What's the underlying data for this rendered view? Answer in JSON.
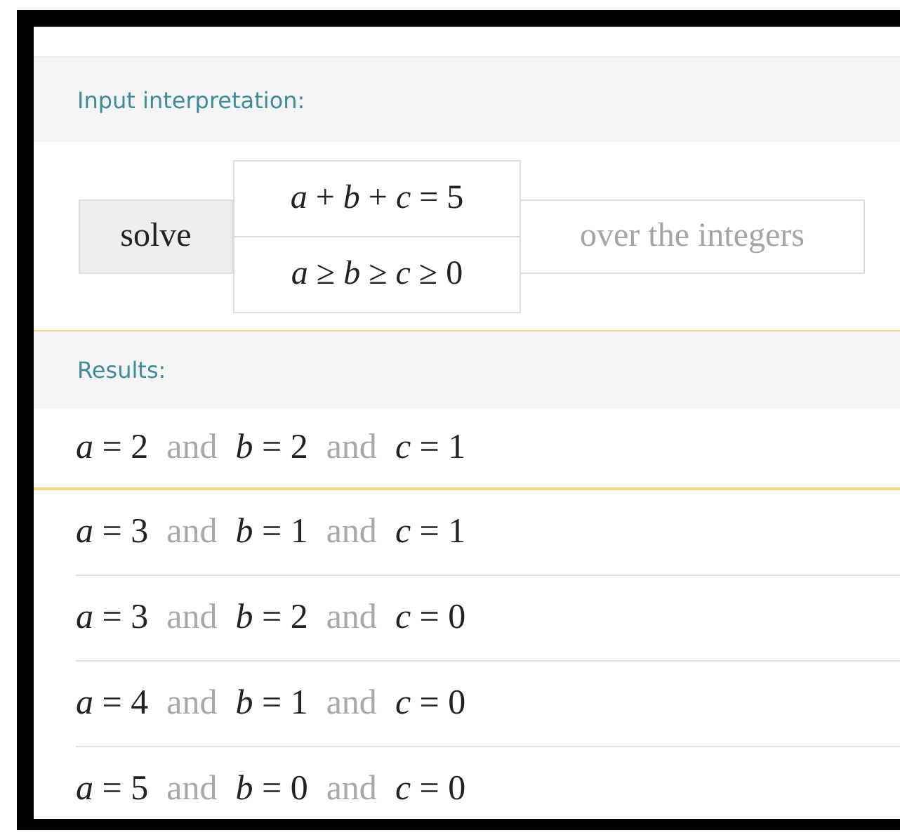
{
  "input_interpretation": {
    "heading": "Input interpretation:",
    "command": "solve",
    "equations": [
      "*a* + *b* + *c* = 5",
      "*a* ≥ *b* ≥ *c* ≥ 0"
    ],
    "domain": "over the integers"
  },
  "results": {
    "heading": "Results:",
    "rows": [
      {
        "parts": [
          {
            "kind": "eq",
            "text": "*a* = 2"
          },
          {
            "kind": "word",
            "text": "and"
          },
          {
            "kind": "eq",
            "text": "*b* = 2"
          },
          {
            "kind": "word",
            "text": "and"
          },
          {
            "kind": "eq",
            "text": "*c* = 1"
          }
        ]
      },
      {
        "parts": [
          {
            "kind": "eq",
            "text": "*a* = 3"
          },
          {
            "kind": "word",
            "text": "and"
          },
          {
            "kind": "eq",
            "text": "*b* = 1"
          },
          {
            "kind": "word",
            "text": "and"
          },
          {
            "kind": "eq",
            "text": "*c* = 1"
          }
        ]
      },
      {
        "parts": [
          {
            "kind": "eq",
            "text": "*a* = 3"
          },
          {
            "kind": "word",
            "text": "and"
          },
          {
            "kind": "eq",
            "text": "*b* = 2"
          },
          {
            "kind": "word",
            "text": "and"
          },
          {
            "kind": "eq",
            "text": "*c* = 0"
          }
        ]
      },
      {
        "parts": [
          {
            "kind": "eq",
            "text": "*a* = 4"
          },
          {
            "kind": "word",
            "text": "and"
          },
          {
            "kind": "eq",
            "text": "*b* = 1"
          },
          {
            "kind": "word",
            "text": "and"
          },
          {
            "kind": "eq",
            "text": "*c* = 0"
          }
        ]
      },
      {
        "parts": [
          {
            "kind": "eq",
            "text": "*a* = 5"
          },
          {
            "kind": "word",
            "text": "and"
          },
          {
            "kind": "eq",
            "text": "*b* = 0"
          },
          {
            "kind": "word",
            "text": "and"
          },
          {
            "kind": "eq",
            "text": "*c* = 0"
          }
        ]
      }
    ]
  }
}
